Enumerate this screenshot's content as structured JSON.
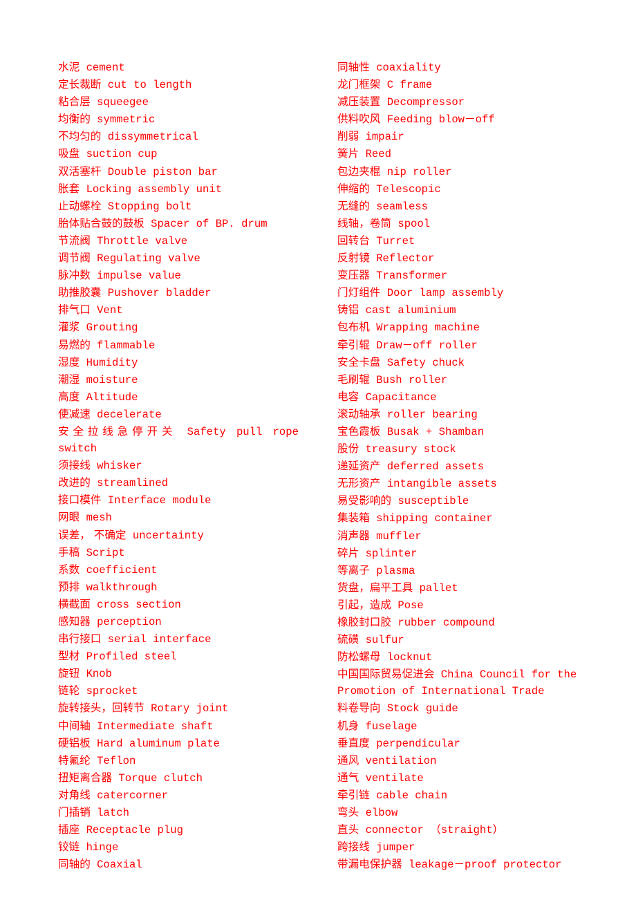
{
  "document": {
    "text_color": "#ff0000",
    "left_column": [
      {
        "zh": "水泥",
        "en": "cement"
      },
      {
        "zh": "定长裁断",
        "en": "cut to length"
      },
      {
        "zh": "粘合层",
        "en": "squeegee"
      },
      {
        "zh": "均衡的",
        "en": "symmetric"
      },
      {
        "zh": "不均匀的",
        "en": "dissymmetrical"
      },
      {
        "zh": "吸盘",
        "en": "suction cup"
      },
      {
        "zh": "双活塞杆",
        "en": "Double piston bar"
      },
      {
        "zh": "胀套",
        "en": "Locking assembly unit"
      },
      {
        "zh": "止动螺栓",
        "en": "Stopping bolt"
      },
      {
        "zh": "胎体贴合鼓的鼓板",
        "en": "Spacer of BP. drum"
      },
      {
        "zh": "节流阀",
        "en": "Throttle valve"
      },
      {
        "zh": "调节阀",
        "en": "Regulating valve"
      },
      {
        "zh": "脉冲数",
        "en": "impulse value"
      },
      {
        "zh": "助推胶囊",
        "en": "Pushover bladder"
      },
      {
        "zh": "排气口",
        "en": "Vent"
      },
      {
        "zh": "灌浆",
        "en": "Grouting"
      },
      {
        "zh": "易燃的",
        "en": "flammable"
      },
      {
        "zh": "湿度",
        "en": "Humidity"
      },
      {
        "zh": "潮湿",
        "en": "moisture"
      },
      {
        "zh": "高度",
        "en": "Altitude"
      },
      {
        "zh": "使减速",
        "en": "decelerate"
      },
      {
        "zh": "安全拉线急停开关",
        "en": "Safety pull rope switch",
        "justify": true
      },
      {
        "zh": "须接线",
        "en": "whisker"
      },
      {
        "zh": "改进的",
        "en": "streamlined"
      },
      {
        "zh": "接口模件",
        "en": "Interface module"
      },
      {
        "zh": "网眼",
        "en": "mesh"
      },
      {
        "zh": "误差， 不确定",
        "en": "uncertainty"
      },
      {
        "zh": "手稿",
        "en": "Script"
      },
      {
        "zh": "系数",
        "en": "coefficient"
      },
      {
        "zh": "预排",
        "en": "walkthrough"
      },
      {
        "zh": "横截面",
        "en": "cross section"
      },
      {
        "zh": "感知器",
        "en": "perception"
      },
      {
        "zh": "串行接口",
        "en": "serial interface"
      },
      {
        "zh": "型材",
        "en": "Profiled steel"
      },
      {
        "zh": "旋钮",
        "en": "Knob"
      },
      {
        "zh": "链轮",
        "en": "sprocket"
      },
      {
        "zh": "旋转接头，回转节",
        "en": "Rotary joint"
      },
      {
        "zh": "中间轴",
        "en": "Intermediate shaft"
      },
      {
        "zh": "硬铝板",
        "en": "Hard aluminum plate"
      },
      {
        "zh": "特氟纶",
        "en": "Teflon"
      },
      {
        "zh": "扭矩离合器",
        "en": "Torque clutch"
      },
      {
        "zh": "对角线",
        "en": "catercorner"
      },
      {
        "zh": "门插销",
        "en": "latch"
      },
      {
        "zh": "插座",
        "en": "Receptacle plug"
      },
      {
        "zh": "铰链",
        "en": "hinge"
      },
      {
        "zh": "同轴的",
        "en": "Coaxial"
      }
    ],
    "right_column": [
      {
        "zh": "同轴性",
        "en": "coaxiality"
      },
      {
        "zh": "龙门框架",
        "en": "C frame"
      },
      {
        "zh": "减压装置",
        "en": "Decompressor"
      },
      {
        "zh": "供料吹风",
        "en": "Feeding blow－off"
      },
      {
        "zh": "削弱",
        "en": "impair"
      },
      {
        "zh": "簧片",
        "en": "Reed"
      },
      {
        "zh": "包边夹棍",
        "en": "nip roller"
      },
      {
        "zh": "伸缩的",
        "en": "Telescopic"
      },
      {
        "zh": "无缝的",
        "en": "seamless"
      },
      {
        "zh": "线轴，卷筒",
        "en": "spool"
      },
      {
        "zh": "回转台",
        "en": "Turret"
      },
      {
        "zh": "反射镜",
        "en": "Reflector"
      },
      {
        "zh": "变压器",
        "en": "Transformer"
      },
      {
        "zh": "门灯组件",
        "en": "Door lamp assembly"
      },
      {
        "zh": "铸铝",
        "en": "cast aluminium"
      },
      {
        "zh": "包布机",
        "en": "Wrapping machine"
      },
      {
        "zh": "牵引辊",
        "en": "Draw－off roller"
      },
      {
        "zh": "安全卡盘",
        "en": "Safety chuck"
      },
      {
        "zh": "毛刷辊",
        "en": "Bush roller"
      },
      {
        "zh": "电容",
        "en": "Capacitance"
      },
      {
        "zh": "滚动轴承",
        "en": "roller bearing"
      },
      {
        "zh": "宝色霞板",
        "en": "Busak + Shamban"
      },
      {
        "zh": "股份",
        "en": "treasury stock"
      },
      {
        "zh": "递延资产",
        "en": "deferred assets"
      },
      {
        "zh": "无形资产",
        "en": "intangible assets"
      },
      {
        "zh": "易受影响的",
        "en": "susceptible"
      },
      {
        "zh": "集装箱",
        "en": "shipping container"
      },
      {
        "zh": "消声器",
        "en": "muffler"
      },
      {
        "zh": "碎片",
        "en": "splinter"
      },
      {
        "zh": "等离子",
        "en": "plasma"
      },
      {
        "zh": "货盘，扁平工具",
        "en": "pallet"
      },
      {
        "zh": "引起，造成",
        "en": "Pose"
      },
      {
        "zh": "橡胶封口胶",
        "en": "rubber compound"
      },
      {
        "zh": "硫磺",
        "en": "sulfur"
      },
      {
        "zh": "防松螺母",
        "en": "locknut"
      },
      {
        "zh": "中国国际贸易促进会",
        "en": "China Council for the Promotion of International Trade"
      },
      {
        "zh": "料卷导向",
        "en": "Stock guide"
      },
      {
        "zh": "机身",
        "en": "fuselage"
      },
      {
        "zh": "垂直度",
        "en": "perpendicular"
      },
      {
        "zh": "通风",
        "en": "ventilation"
      },
      {
        "zh": "通气",
        "en": "ventilate"
      },
      {
        "zh": "牵引链",
        "en": "cable chain"
      },
      {
        "zh": "弯头",
        "en": "elbow"
      },
      {
        "zh": "直头",
        "en": "connector （straight）"
      },
      {
        "zh": "跨接线",
        "en": "jumper"
      },
      {
        "zh": "带漏电保护器",
        "en": "leakage－proof protector"
      }
    ]
  }
}
